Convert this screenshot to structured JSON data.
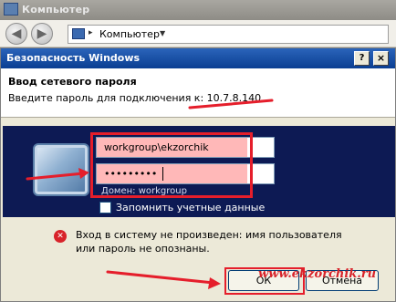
{
  "explorer": {
    "title": "Компьютер",
    "address_text": "Компьютер"
  },
  "dialog": {
    "title": "Безопасность Windows",
    "header_title": "Ввод сетевого пароля",
    "header_prompt": "Введите пароль для подключения к: 10.7.8.140",
    "username_value": "workgroup\\ekzorchik",
    "password_mask": "•••••••••",
    "domain_label": "Домен: workgroup",
    "remember_label": "Запомнить учетные данные",
    "remember_checked": false,
    "error_message": "Вход в систему не произведен: имя пользователя или пароль не опознаны.",
    "ok_label": "ОК",
    "cancel_label": "Отмена",
    "help_glyph": "?",
    "close_glyph": "×"
  },
  "watermark": "www.ekzorchik.ru",
  "colors": {
    "titlebar": "#0a3e92",
    "panel": "#0d1a54",
    "highlight": "#e51e2b",
    "field_fill": "#ffb8b8"
  },
  "icons": {
    "back": "back-arrow-icon",
    "forward": "forward-arrow-icon",
    "computer": "computer-icon",
    "monitor": "monitor-icon",
    "error": "error-icon"
  }
}
